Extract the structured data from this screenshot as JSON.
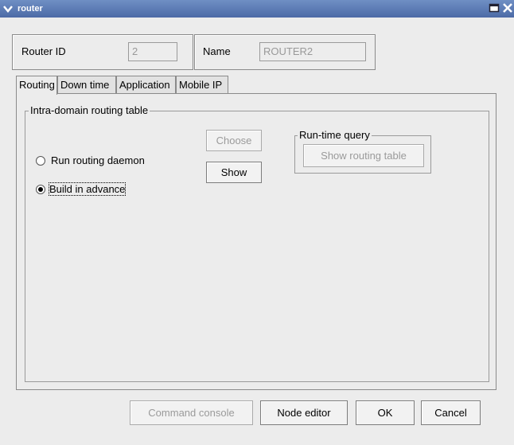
{
  "window": {
    "title": "router",
    "menu_icon": "chevron-down-icon",
    "restore_icon": "window-restore-icon",
    "close_icon": "close-icon"
  },
  "header": {
    "router_id_label": "Router ID",
    "router_id_value": "2",
    "name_label": "Name",
    "name_value": "ROUTER2"
  },
  "tabs": [
    {
      "label": "Routing",
      "active": true
    },
    {
      "label": "Down time",
      "active": false
    },
    {
      "label": "Application",
      "active": false
    },
    {
      "label": "Mobile IP",
      "active": false
    }
  ],
  "routing": {
    "group_title": "Intra-domain routing table",
    "options": [
      {
        "label": "Run routing daemon",
        "selected": false
      },
      {
        "label": "Build in advance",
        "selected": true
      }
    ],
    "choose_label": "Choose",
    "show_label": "Show",
    "runtime_group_title": "Run-time query",
    "show_routing_table_label": "Show routing table"
  },
  "footer": {
    "command_console_label": "Command console",
    "node_editor_label": "Node editor",
    "ok_label": "OK",
    "cancel_label": "Cancel"
  }
}
